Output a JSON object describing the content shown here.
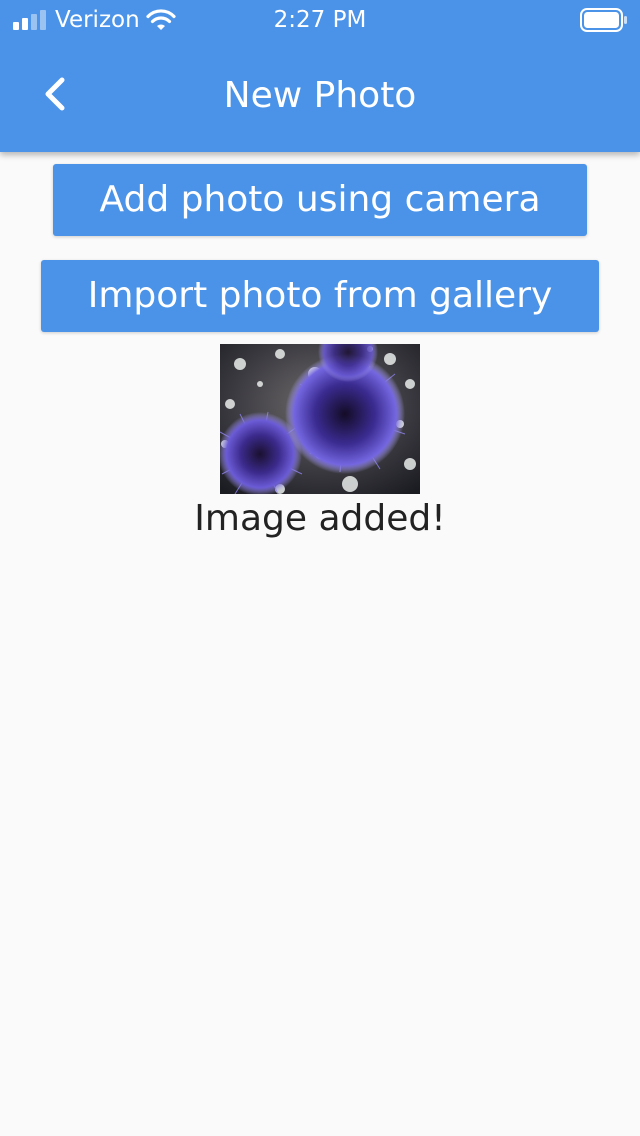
{
  "status_bar": {
    "carrier": "Verizon",
    "time": "2:27 PM",
    "signal_icon": "cellular-signal-icon",
    "wifi_icon": "wifi-icon",
    "battery_icon": "battery-icon"
  },
  "app_bar": {
    "title": "New Photo",
    "back_icon": "chevron-left-icon",
    "color": "#4a93e8"
  },
  "actions": {
    "camera_label": "Add photo using camera",
    "gallery_label": "Import photo from gallery"
  },
  "photo": {
    "subject": "purple sea urchins"
  },
  "status_message": "Image added!"
}
